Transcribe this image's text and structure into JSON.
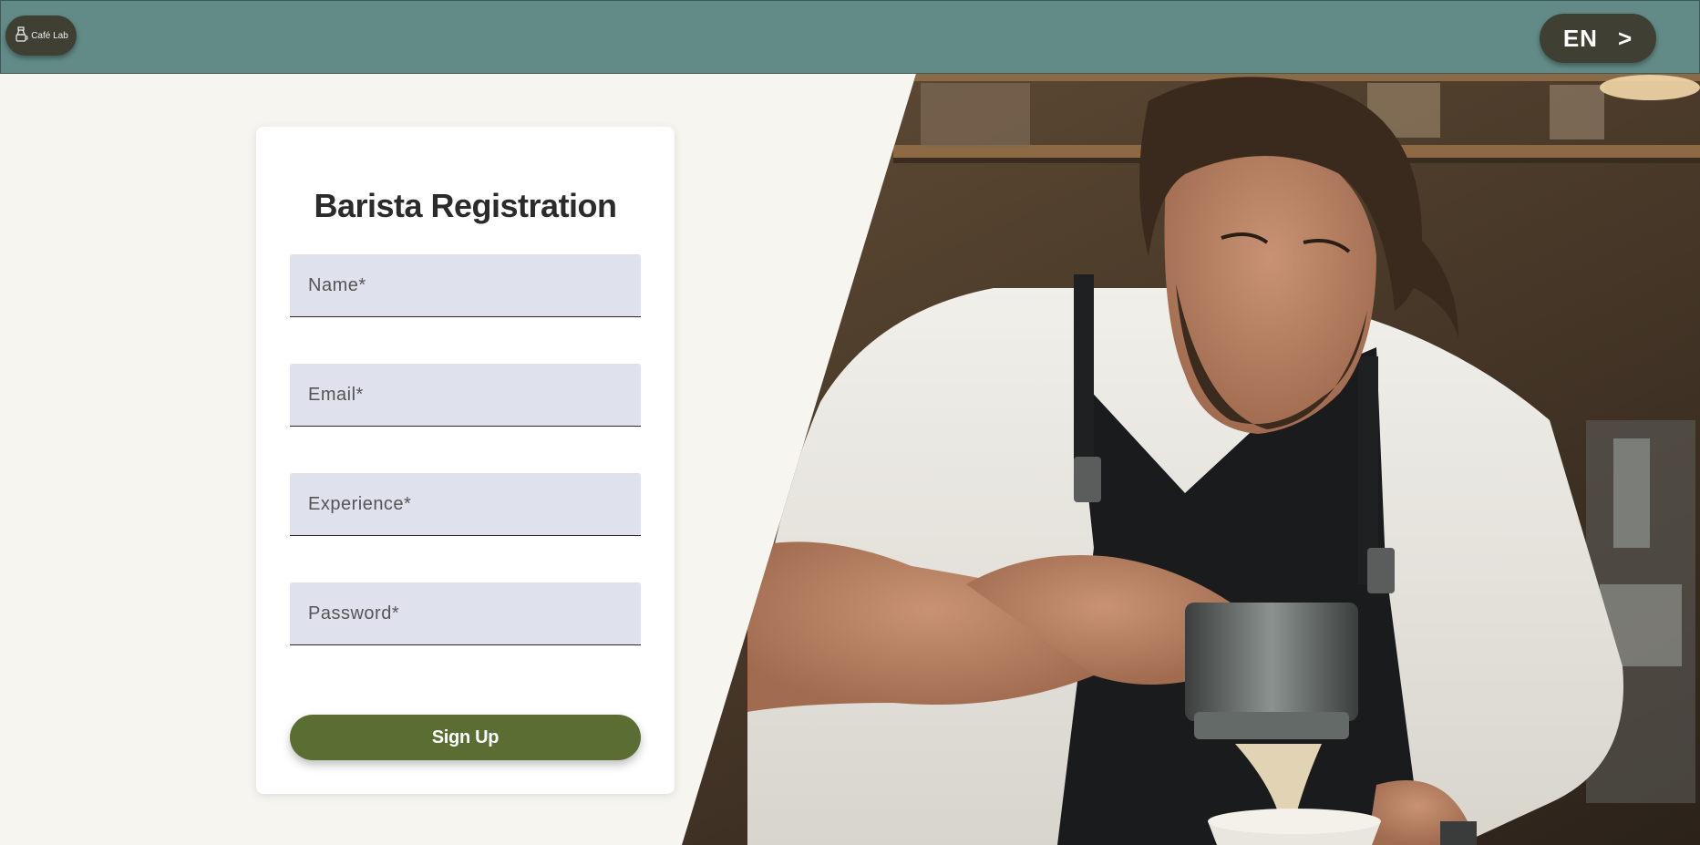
{
  "header": {
    "logo_text": "Café Lab",
    "logo_icon": "coffee-maker-icon",
    "language_label": "EN",
    "language_arrow": ">"
  },
  "form": {
    "title": "Barista Registration",
    "fields": [
      {
        "placeholder": "Name*"
      },
      {
        "placeholder": "Email*"
      },
      {
        "placeholder": "Experience*"
      },
      {
        "placeholder": "Password*"
      }
    ],
    "submit_label": "Sign Up"
  },
  "colors": {
    "header_bg": "#628b87",
    "pill_bg": "#3f4033",
    "page_bg": "#f7f5f0",
    "field_bg": "#dfe1ec",
    "button_bg": "#5a6d33"
  }
}
